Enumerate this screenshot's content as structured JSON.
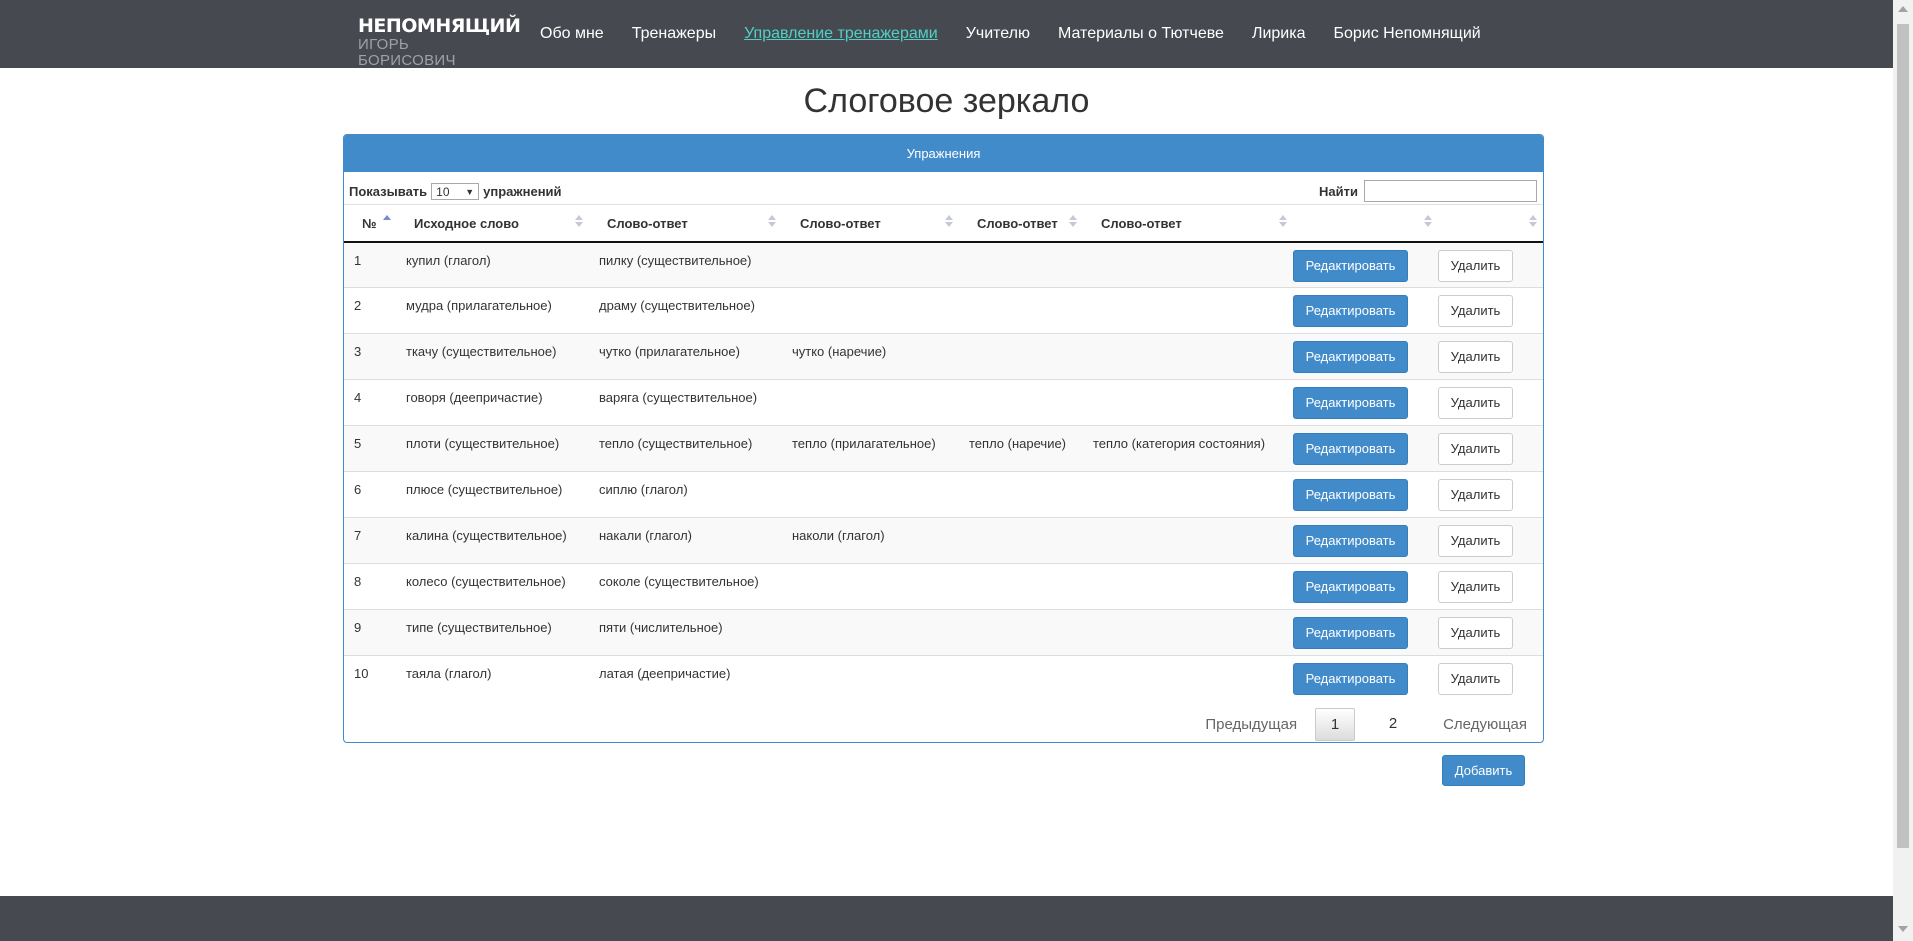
{
  "logo": {
    "line1": "НЕПОМНЯЩИЙ",
    "line2": "ИГОРЬ БОРИСОВИЧ"
  },
  "nav": [
    {
      "label": "Обо мне",
      "active": false
    },
    {
      "label": "Тренажеры",
      "active": false
    },
    {
      "label": "Управление тренажерами",
      "active": true
    },
    {
      "label": "Учителю",
      "active": false
    },
    {
      "label": "Материалы о Тютчеве",
      "active": false
    },
    {
      "label": "Лирика",
      "active": false
    },
    {
      "label": "Борис Непомнящий",
      "active": false
    }
  ],
  "page": {
    "title": "Слоговое зеркало"
  },
  "panel": {
    "heading": "Упражнения"
  },
  "controls": {
    "show_label": "Показывать",
    "length_value": "10",
    "length_suffix": "упражнений",
    "search_label": "Найти",
    "search_value": ""
  },
  "table": {
    "headers": [
      "№",
      "Исходное слово",
      "Слово-ответ",
      "Слово-ответ",
      "Слово-ответ",
      "Слово-ответ",
      "",
      ""
    ],
    "rows": [
      [
        "1",
        "купил (глагол)",
        "пилку (существительное)",
        "",
        "",
        ""
      ],
      [
        "2",
        "мудра (прилагательное)",
        "драму (существительное)",
        "",
        "",
        ""
      ],
      [
        "3",
        "ткачу (существительное)",
        "чутко (прилагательное)",
        "чутко (наречие)",
        "",
        ""
      ],
      [
        "4",
        "говоря (деепричастие)",
        "варяга (существительное)",
        "",
        "",
        ""
      ],
      [
        "5",
        "плоти (существительное)",
        "тепло (существительное)",
        "тепло (прилагательное)",
        "тепло (наречие)",
        "тепло (категория состояния)"
      ],
      [
        "6",
        "плюсе (существительное)",
        "сиплю (глагол)",
        "",
        "",
        ""
      ],
      [
        "7",
        "калина (существительное)",
        "накали (глагол)",
        "наколи (глагол)",
        "",
        ""
      ],
      [
        "8",
        "колесо (существительное)",
        "соколе (существительное)",
        "",
        "",
        ""
      ],
      [
        "9",
        "типе (существительное)",
        "пяти (числительное)",
        "",
        "",
        ""
      ],
      [
        "10",
        "таяла (глагол)",
        "латая (деепричастие)",
        "",
        "",
        ""
      ]
    ],
    "edit_label": "Редактировать",
    "delete_label": "Удалить"
  },
  "pagination": {
    "prev": "Предыдущая",
    "pages": [
      "1",
      "2"
    ],
    "current": "1",
    "next": "Следующая"
  },
  "add_button": "Добавить",
  "colors": {
    "navbar": "#464950",
    "accent": "#428bca",
    "active_link": "#4fd1c5"
  }
}
